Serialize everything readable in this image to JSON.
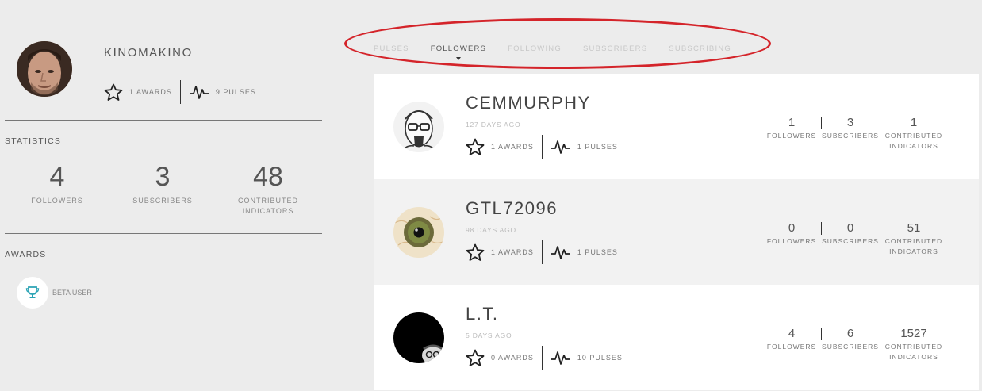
{
  "profile": {
    "username": "KINOMAKINO",
    "awards": "1 AWARDS",
    "pulses": "9 PULSES"
  },
  "statistics": {
    "heading": "STATISTICS",
    "followers_value": "4",
    "followers_label": "FOLLOWERS",
    "subscribers_value": "3",
    "subscribers_label": "SUBSCRIBERS",
    "contributed_value": "48",
    "contributed_label_1": "CONTRIBUTED",
    "contributed_label_2": "INDICATORS"
  },
  "awards_section": {
    "heading": "AWARDS",
    "badge_label": "BETA USER",
    "badge_icon": "trophy-icon",
    "badge_color": "#2aa3b4"
  },
  "tabs": [
    "PULSES",
    "FOLLOWERS",
    "FOLLOWING",
    "SUBSCRIBERS",
    "SUBSCRIBING"
  ],
  "active_tab": "FOLLOWERS",
  "annotation_color": "#d4242a",
  "followers": [
    {
      "name": "CEMMURPHY",
      "time": "127 DAYS AGO",
      "awards": "1 AWARDS",
      "pulses": "1 PULSES",
      "followers": "1",
      "subscribers": "3",
      "indicators": "1"
    },
    {
      "name": "GTL72096",
      "time": "98 DAYS AGO",
      "awards": "1 AWARDS",
      "pulses": "1 PULSES",
      "followers": "0",
      "subscribers": "0",
      "indicators": "51"
    },
    {
      "name": "L.T.",
      "time": "5 DAYS AGO",
      "awards": "0 AWARDS",
      "pulses": "10 PULSES",
      "followers": "4",
      "subscribers": "6",
      "indicators": "1527"
    }
  ],
  "count_labels": {
    "followers": "FOLLOWERS",
    "subscribers": "SUBSCRIBERS",
    "indicators_1": "CONTRIBUTED",
    "indicators_2": "INDICATORS"
  }
}
